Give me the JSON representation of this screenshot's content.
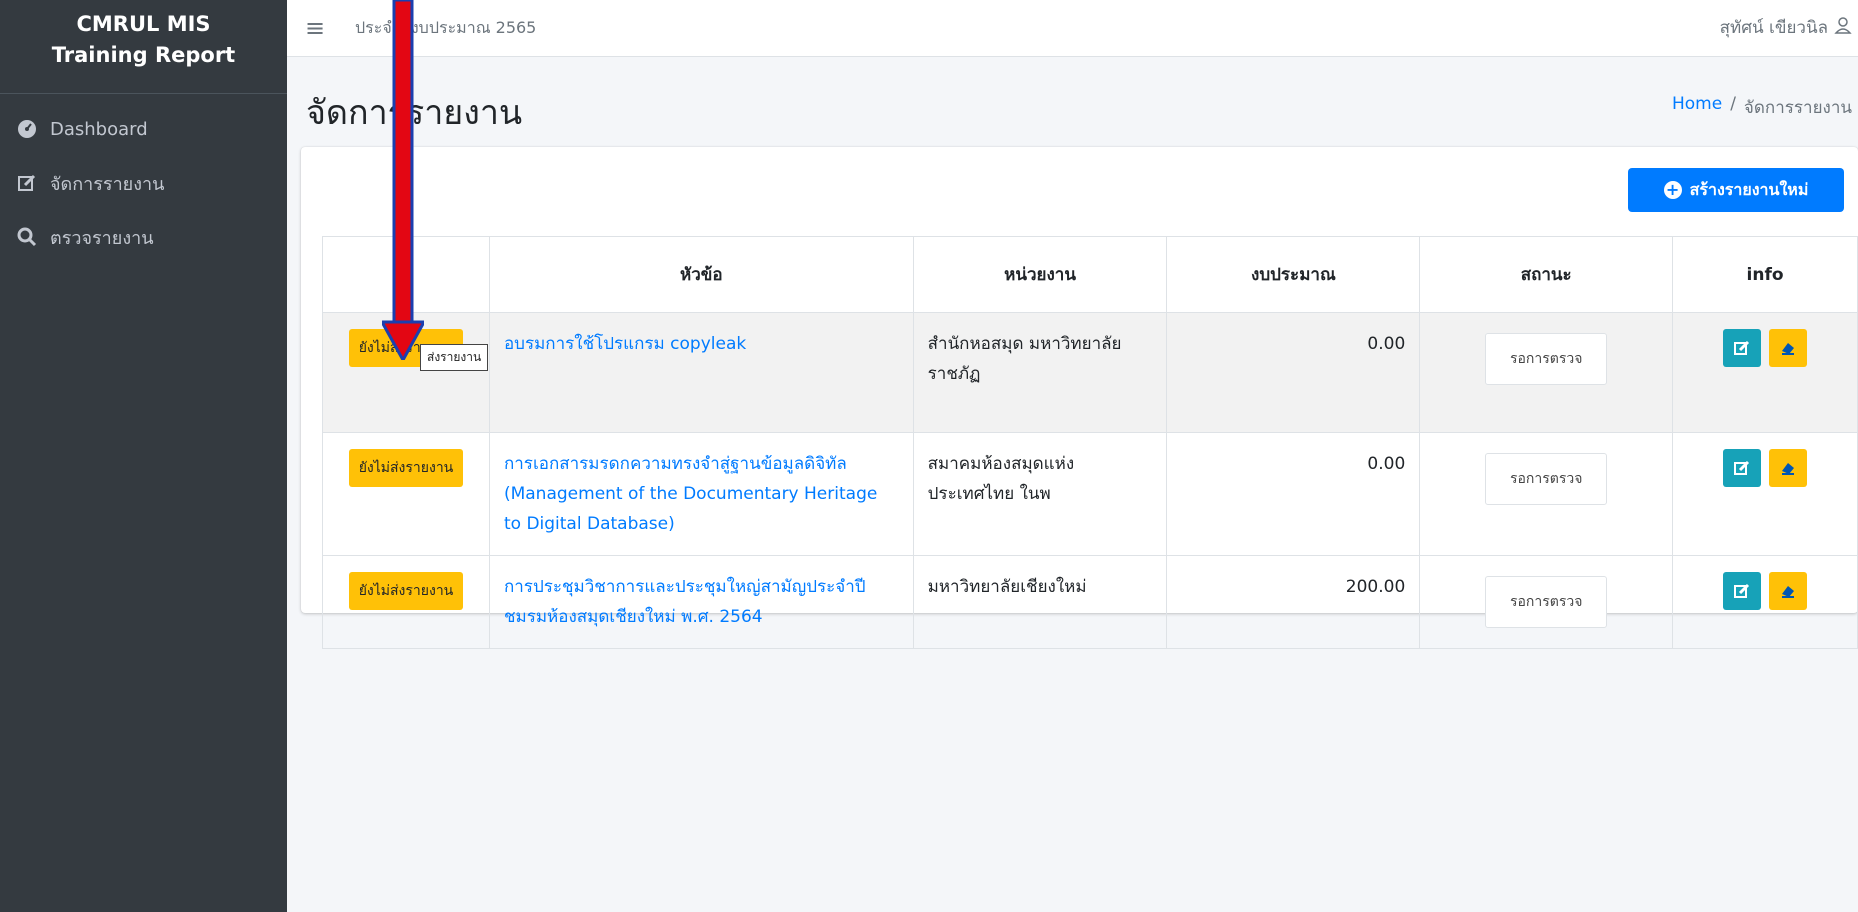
{
  "sidebar": {
    "brand_line1": "CMRUL MIS",
    "brand_line2": "Training Report",
    "items": [
      {
        "label": "Dashboard",
        "icon": "dashboard-icon"
      },
      {
        "label": "จัดการรายงาน",
        "icon": "edit-icon"
      },
      {
        "label": "ตรวจรายงาน",
        "icon": "search-icon"
      }
    ]
  },
  "topbar": {
    "fiscal_year": "ปีงบประมาณ 2565",
    "fiscal_partial": "ประจำปีงบประมาณ 2565",
    "user_name": "สุทัศน์ เขียวนิล"
  },
  "header": {
    "title": "จัดการรายงาน",
    "breadcrumb_home": "Home",
    "breadcrumb_sep": "/",
    "breadcrumb_current": "จัดการรายงาน"
  },
  "toolbar": {
    "new_report_label": "สร้างรายงานใหม่"
  },
  "table": {
    "headers": [
      "#",
      "หัวข้อ",
      "หน่วยงาน",
      "งบประมาณ",
      "สถานะ",
      "info"
    ],
    "rows": [
      {
        "action": "ยังไม่ส่งรายงาน",
        "title": "อบรมการใช้โปรแกรม copyleak",
        "unit": "สำนักหอสมุด มหาวิทยาลัยราชภัฏ",
        "budget": "0.00",
        "status": "รอการตรวจ"
      },
      {
        "action": "ยังไม่ส่งรายงาน",
        "title": "การเอกสารมรดกความทรงจำสู่ฐานข้อมูลดิจิทัล (Management of the Documentary Heritage to Digital Database)",
        "unit": "สมาคมห้องสมุดแห่งประเทศไทย ในพ",
        "budget": "0.00",
        "status": "รอการตรวจ"
      },
      {
        "action": "ยังไม่ส่งรายงาน",
        "title": "การประชุมวิชาการและประชุมใหญ่สามัญประจำปี ชมรมห้องสมุดเชียงใหม่ พ.ศ. 2564",
        "unit": "มหาวิทยาลัยเชียงใหม่",
        "budget": "200.00",
        "status": "รอการตรวจ"
      }
    ]
  },
  "tooltip": {
    "text": "ส่งรายงาน"
  },
  "colors": {
    "sidebar_bg": "#343a40",
    "primary": "#007bff",
    "warning": "#ffc107",
    "info": "#17a2b8",
    "annotation_arrow": "#e30613"
  }
}
